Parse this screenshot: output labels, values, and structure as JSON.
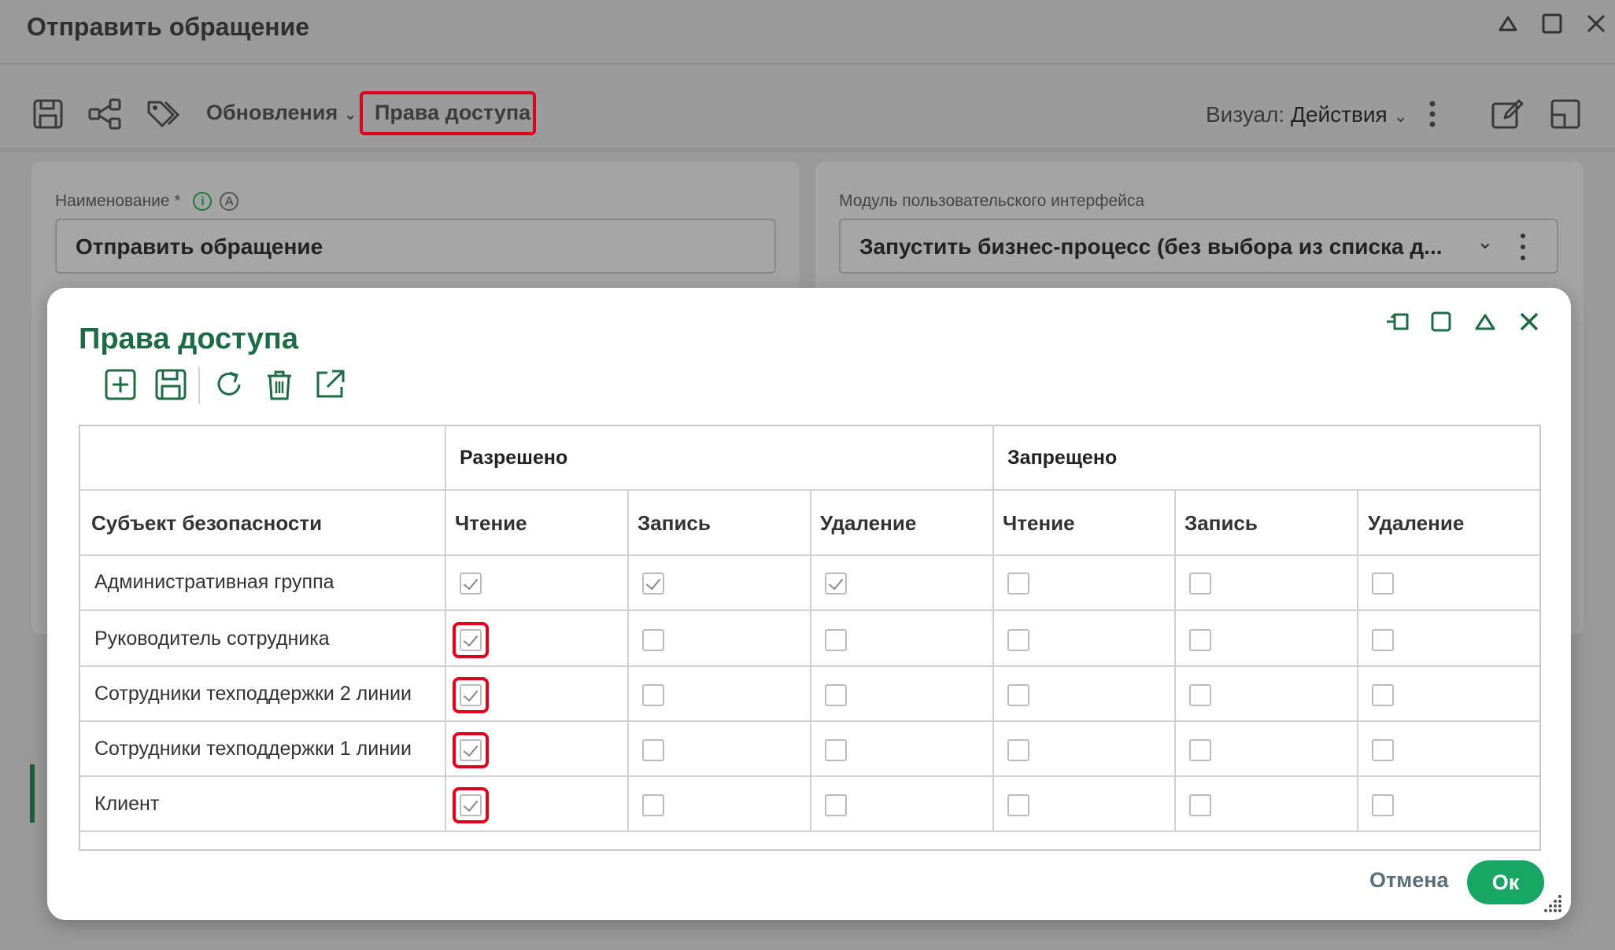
{
  "window": {
    "title": "Отправить обращение"
  },
  "toolbar": {
    "updates_label": "Обновления",
    "access_label": "Права доступа",
    "visual_prefix": "Визуал:",
    "visual_value": "Действия"
  },
  "form": {
    "name_label": "Наименование *",
    "name_value": "Отправить обращение",
    "module_label": "Модуль пользовательского интерфейса",
    "module_value": "Запустить бизнес-процесс (без выбора из списка д..."
  },
  "modal": {
    "title": "Права доступа",
    "group_allowed": "Разрешено",
    "group_denied": "Запрещено",
    "subject_header": "Субъект безопасности",
    "columns": [
      "Чтение",
      "Запись",
      "Удаление",
      "Чтение",
      "Запись",
      "Удаление"
    ],
    "rows": [
      {
        "subject": "Административная группа",
        "checks": [
          true,
          true,
          true,
          false,
          false,
          false
        ]
      },
      {
        "subject": "Руководитель сотрудника",
        "checks": [
          true,
          false,
          false,
          false,
          false,
          false
        ]
      },
      {
        "subject": "Сотрудники техподдержки 2 линии",
        "checks": [
          true,
          false,
          false,
          false,
          false,
          false
        ]
      },
      {
        "subject": "Сотрудники техподдержки 1 линии",
        "checks": [
          true,
          false,
          false,
          false,
          false,
          false
        ]
      },
      {
        "subject": "Клиент",
        "checks": [
          true,
          false,
          false,
          false,
          false,
          false
        ]
      }
    ],
    "cancel_label": "Отмена",
    "ok_label": "Ок"
  },
  "colors": {
    "accent_green": "#1f6b45",
    "ok_button": "#19a664",
    "highlight_red": "#e0001b"
  }
}
